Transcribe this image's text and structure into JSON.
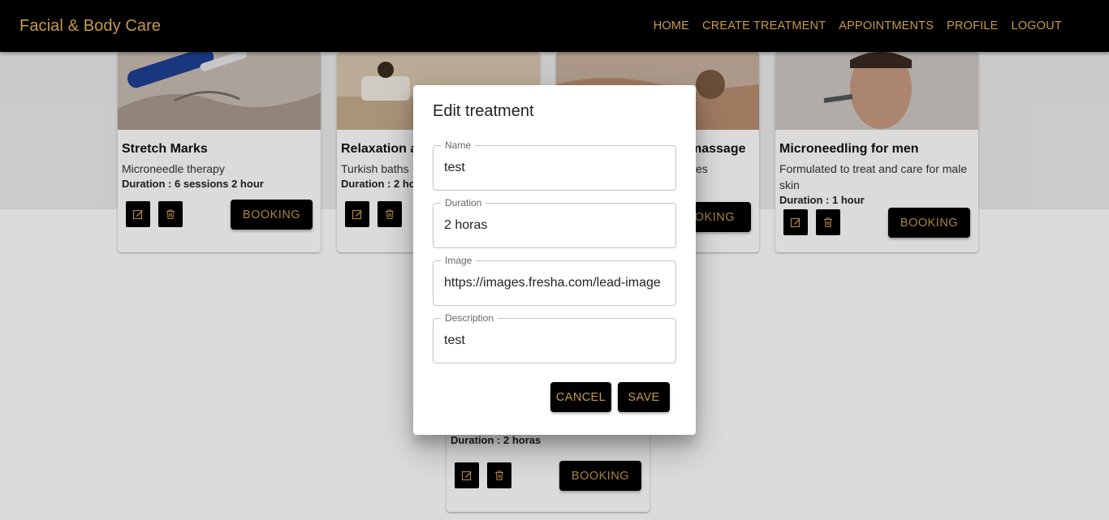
{
  "app": {
    "title": "Facial & Body Care"
  },
  "nav": {
    "home": "HOME",
    "create": "CREATE TREATMENT",
    "appointments": "APPOINTMENTS",
    "profile": "PROFILE",
    "logout": "LOGOUT"
  },
  "cards": [
    {
      "title": "Stretch Marks",
      "description": "Microneedle therapy",
      "duration": "Duration : 6 sessions 2 hour",
      "booking": "BOOKING"
    },
    {
      "title": "Relaxation a",
      "description": "Turkish baths",
      "duration": "Duration : 2 ho",
      "booking": "BOOKING"
    },
    {
      "title": "massage",
      "description": "ses",
      "duration": "",
      "booking": "OOKING"
    },
    {
      "title": "Microneedling for men",
      "description": "Formulated to treat and care for male skin",
      "duration": "Duration : 1 hour",
      "booking": "BOOKING"
    },
    {
      "title": "",
      "description": "",
      "duration": "Duration : 2 horas",
      "booking": "BOOKING"
    }
  ],
  "dialog": {
    "title": "Edit treatment",
    "fields": {
      "name": {
        "label": "Name",
        "value": "test"
      },
      "duration": {
        "label": "Duration",
        "value": "2 horas"
      },
      "image": {
        "label": "Image",
        "value": "https://images.fresha.com/lead-image"
      },
      "description": {
        "label": "Description",
        "value": "test"
      }
    },
    "cancel": "CANCEL",
    "save": "SAVE"
  },
  "colors": {
    "accent": "#c89a4b",
    "bar": "#000000"
  },
  "icons": {
    "edit": "edit-icon",
    "delete": "trash-icon"
  }
}
